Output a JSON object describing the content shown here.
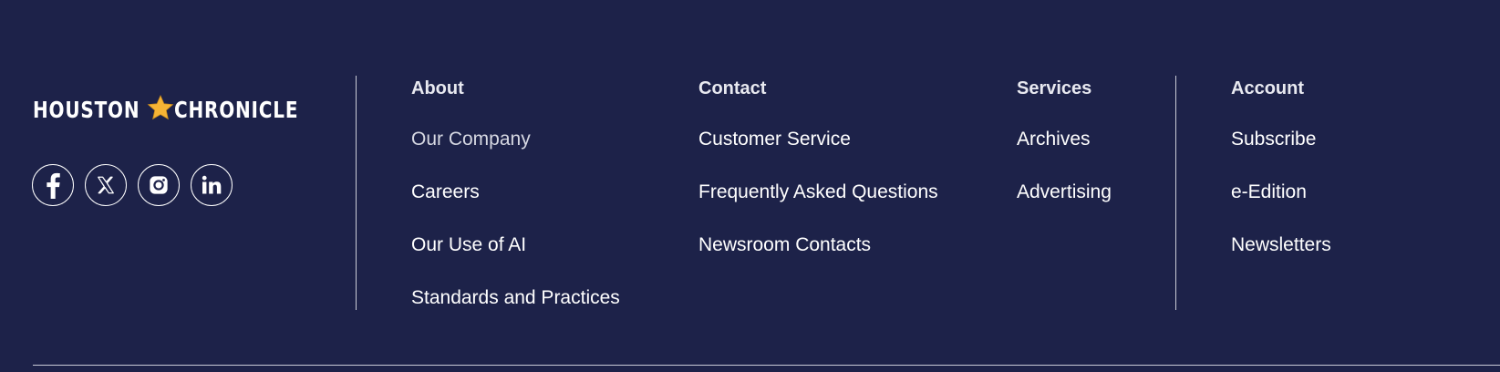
{
  "brand": {
    "word1": "HOUSTON",
    "word2": "CHRONICLE",
    "star_icon": "star-icon",
    "star_color": "#f5b335"
  },
  "social": [
    {
      "name": "facebook-icon"
    },
    {
      "name": "x-twitter-icon"
    },
    {
      "name": "instagram-icon"
    },
    {
      "name": "linkedin-icon"
    }
  ],
  "columns": {
    "about": {
      "heading": "About",
      "links": [
        "Our Company",
        "Careers",
        "Our Use of AI",
        "Standards and Practices"
      ]
    },
    "contact": {
      "heading": "Contact",
      "links": [
        "Customer Service",
        "Frequently Asked Questions",
        "Newsroom Contacts"
      ]
    },
    "services": {
      "heading": "Services",
      "links": [
        "Archives",
        "Advertising"
      ]
    },
    "account": {
      "heading": "Account",
      "links": [
        "Subscribe",
        "e-Edition",
        "Newsletters"
      ]
    }
  },
  "colors": {
    "background": "#1d2249",
    "text": "#ffffff",
    "divider": "#c9cbd6"
  }
}
